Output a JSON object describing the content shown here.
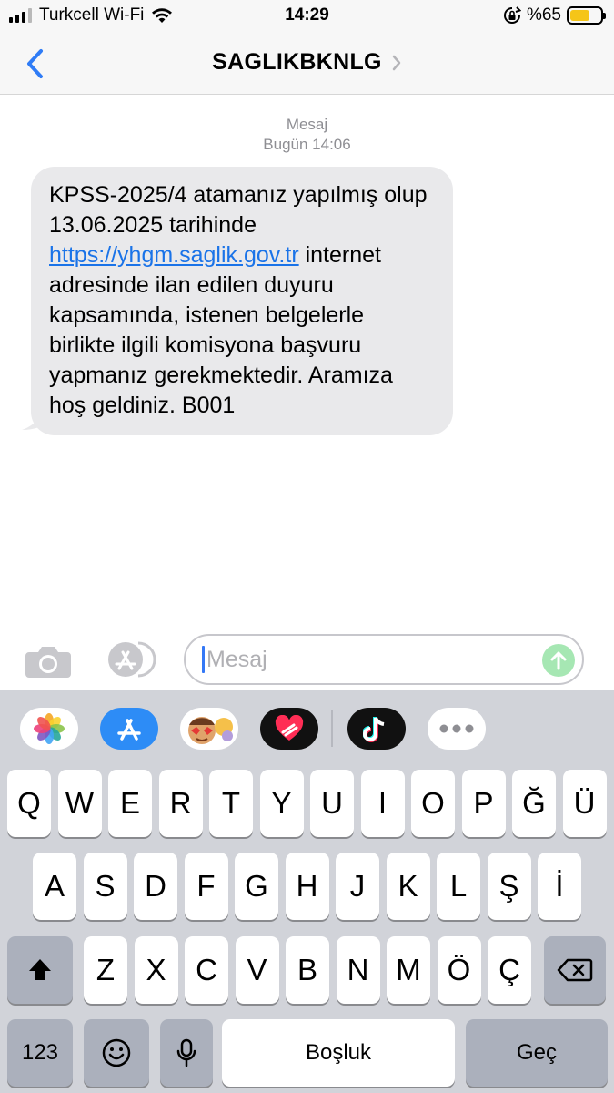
{
  "status_bar": {
    "carrier": "Turkcell Wi-Fi",
    "time": "14:29",
    "battery": "%65",
    "battery_level": 0.65
  },
  "nav": {
    "contact": "SAGLIKBKNLG"
  },
  "thread": {
    "service_label": "Mesaj",
    "timestamp": "Bugün 14:06",
    "message": {
      "text_before": "KPSS-2025/4 atamanız yapılmış olup 13.06.2025 tarihinde ",
      "link": "https://yhgm.saglik.gov.tr",
      "text_after": " internet adresinde ilan edilen duyuru kapsamında, istenen belgelerle birlikte ilgili komisyona başvuru yapmanız gerekmektedir. Aramıza hoş geldiniz. B001"
    }
  },
  "composer": {
    "placeholder": "Mesaj"
  },
  "keyboard": {
    "app_strip": [
      "photos-icon",
      "app-store-icon",
      "memoji-icon",
      "digital-touch-icon",
      "tiktok-icon",
      "more-icon"
    ],
    "row1": [
      "Q",
      "W",
      "E",
      "R",
      "T",
      "Y",
      "U",
      "I",
      "O",
      "P",
      "Ğ",
      "Ü"
    ],
    "row2": [
      "A",
      "S",
      "D",
      "F",
      "G",
      "H",
      "J",
      "K",
      "L",
      "Ş",
      "İ"
    ],
    "row3": [
      "Z",
      "X",
      "C",
      "V",
      "B",
      "N",
      "M",
      "Ö",
      "Ç"
    ],
    "numbers": "123",
    "space": "Boşluk",
    "return": "Geç"
  }
}
